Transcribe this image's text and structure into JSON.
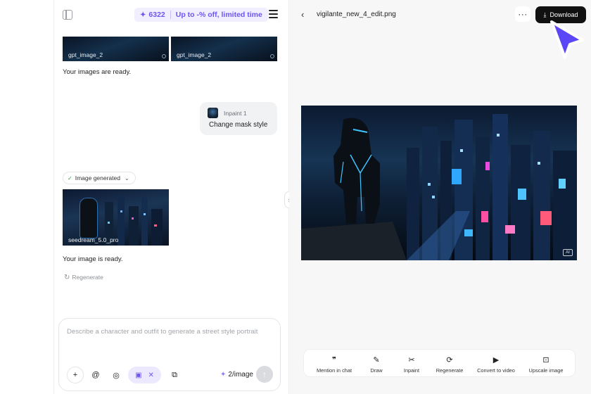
{
  "chat": {
    "promo": {
      "credits": "6322",
      "offer": "Up to -% off, limited time"
    },
    "thumbs": [
      {
        "caption": "gpt_image_2"
      },
      {
        "caption": "gpt_image_2"
      }
    ],
    "images_ready": "Your images are ready.",
    "user_message": {
      "ref_label": "Inpaint 1",
      "text": "Change mask style"
    },
    "status_pill": "Image generated",
    "generated": {
      "caption": "seedream_5.0_pro"
    },
    "image_ready": "Your image is ready.",
    "regenerate_label": "Regenerate",
    "composer": {
      "placeholder": "Describe a character and outfit to generate a street style portrait",
      "image_cost": "2/image"
    }
  },
  "viewer": {
    "filename": "vigilante_new_4_edit.png",
    "download_label": "Download",
    "ai_badge": "AI",
    "toolbar": [
      {
        "label": "Mention in chat",
        "icon": "quote-icon"
      },
      {
        "label": "Draw",
        "icon": "brush-icon"
      },
      {
        "label": "Inpaint",
        "icon": "scissors-icon"
      },
      {
        "label": "Regenerate",
        "icon": "refresh-icon"
      },
      {
        "label": "Convert to video",
        "icon": "play-icon"
      },
      {
        "label": "Upscale image",
        "icon": "upscale-icon"
      }
    ]
  },
  "colors": {
    "accent": "#6c55f0",
    "accent_bg": "#ece9ff",
    "download_bg": "#111111",
    "cursor": "#5b47f5"
  }
}
